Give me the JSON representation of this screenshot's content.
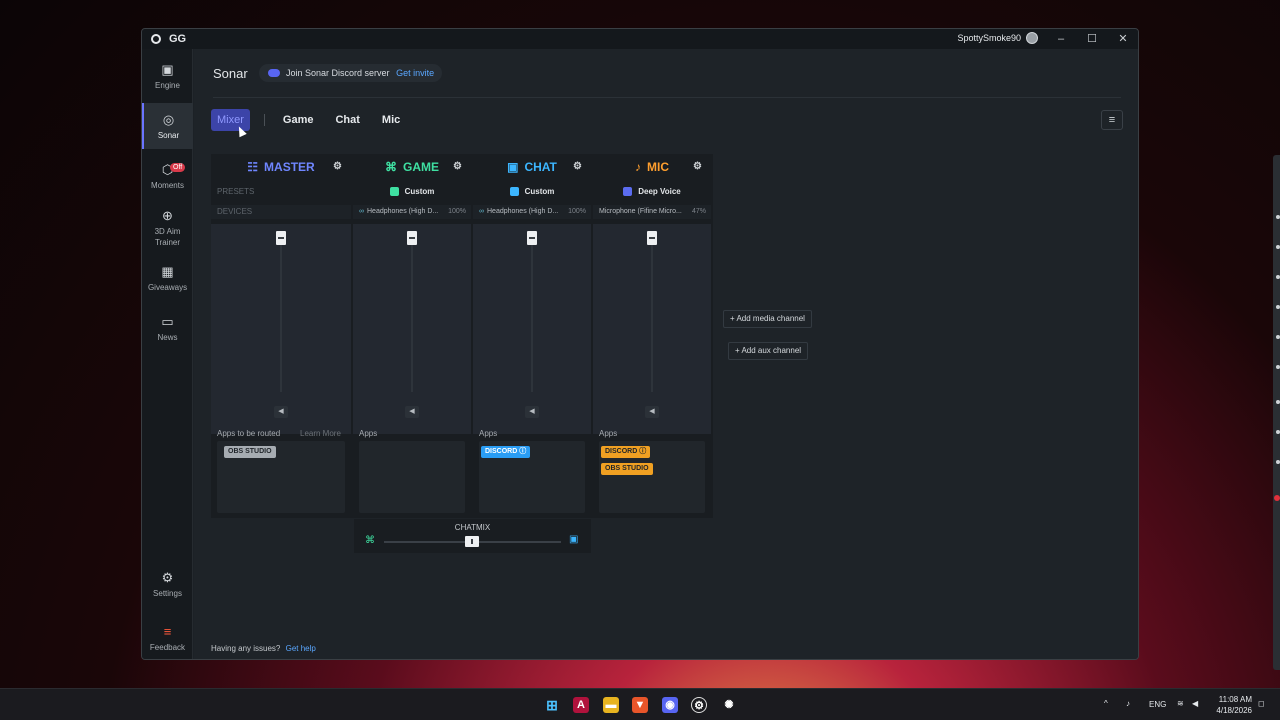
{
  "window": {
    "app_name": "GG",
    "username": "SpottySmoke90",
    "controls": [
      "–",
      "☐",
      "✕"
    ]
  },
  "sidebar": {
    "items": [
      {
        "label": "Engine",
        "icon": "chip-icon"
      },
      {
        "label": "Sonar",
        "icon": "sonar-icon",
        "active": true
      },
      {
        "label": "Moments",
        "icon": "hexagon-icon",
        "badge": "Off"
      },
      {
        "label": "3D Aim Trainer",
        "icon": "crosshair-icon"
      },
      {
        "label": "Giveaways",
        "icon": "gift-icon"
      },
      {
        "label": "News",
        "icon": "book-icon"
      }
    ],
    "settings_label": "Settings",
    "feedback_label": "Feedback"
  },
  "header": {
    "title": "Sonar",
    "discord_text": "Join Sonar Discord server",
    "discord_link": "Get invite"
  },
  "tabs": [
    {
      "label": "Mixer",
      "active": true
    },
    {
      "label": "Game"
    },
    {
      "label": "Chat"
    },
    {
      "label": "Mic"
    }
  ],
  "mixer": {
    "master": {
      "title": "MASTER",
      "presets_label": "PRESETS",
      "devices_label": "DEVICES",
      "apps_label": "Apps to be routed",
      "learn_more": "Learn More",
      "apps": [
        "OBS STUDIO"
      ],
      "accent": "#6f86ff"
    },
    "game": {
      "title": "GAME",
      "preset": "Custom",
      "device": "Headphones (High D...",
      "device_pct": "100%",
      "apps_label": "Apps",
      "apps": [],
      "accent": "#3fe0a2"
    },
    "chat": {
      "title": "CHAT",
      "preset": "Custom",
      "device": "Headphones (High D...",
      "device_pct": "100%",
      "apps_label": "Apps",
      "apps": [
        "DISCORD"
      ],
      "accent": "#3cb6ff"
    },
    "mic": {
      "title": "MIC",
      "preset": "Deep Voice",
      "device": "Microphone (Fifine Micro...",
      "device_pct": "47%",
      "apps_label": "Apps",
      "apps": [
        "DISCORD",
        "OBS STUDIO"
      ],
      "accent": "#ff9f2e"
    },
    "add_media": "Add media channel",
    "add_aux": "Add aux channel",
    "chatmix_label": "CHATMIX"
  },
  "footer": {
    "help_text": "Having any issues?",
    "help_link": "Get help"
  },
  "taskbar": {
    "lang": "ENG",
    "time": "11:08 AM",
    "date": "4/18/2026"
  }
}
